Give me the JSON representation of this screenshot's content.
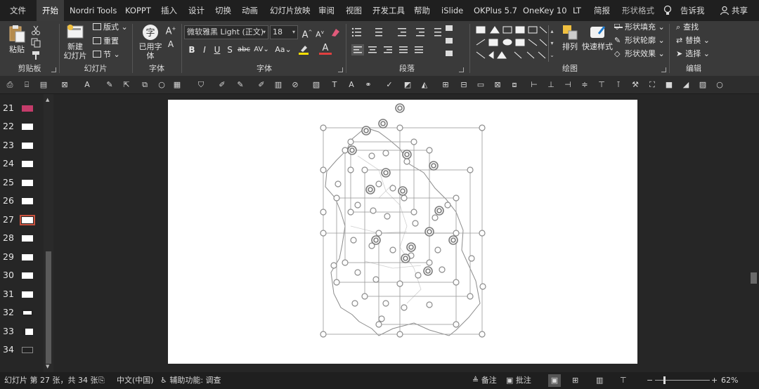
{
  "menu": {
    "tabs": [
      "文件",
      "开始",
      "Nordri Tools",
      "KOPPT",
      "插入",
      "设计",
      "切换",
      "动画",
      "幻灯片放映",
      "审阅",
      "视图",
      "开发工具",
      "帮助",
      "iSlide",
      "OKPlus 5.7",
      "OneKey 10",
      "LT",
      "简报"
    ],
    "context_tab": "形状格式",
    "tell_me": "告诉我",
    "share": "共享"
  },
  "ribbon": {
    "clipboard": {
      "label": "剪贴板",
      "paste": "粘贴"
    },
    "slides": {
      "label": "幻灯片",
      "new_slide_line1": "新建",
      "new_slide_line2": "幻灯片",
      "layout": "版式",
      "reset": "重置",
      "section": "节"
    },
    "font_tools": {
      "label": "字体",
      "btn_line1": "已用字",
      "btn_line2": "体"
    },
    "font": {
      "label": "字体",
      "name": "微软雅黑 Light (正文)",
      "size": "18",
      "bold": "B",
      "italic": "I",
      "underline": "U",
      "shadow": "S",
      "strike": "abc",
      "spacing": "AV",
      "case": "Aa",
      "color": "A"
    },
    "paragraph": {
      "label": "段落"
    },
    "drawing": {
      "label": "绘图",
      "arrange": "排列",
      "quick_styles": "快速样式",
      "fill": "形状填充",
      "outline": "形状轮廓",
      "effects": "形状效果"
    },
    "editing": {
      "label": "编辑",
      "find": "查找",
      "replace": "替换",
      "select": "选择"
    }
  },
  "thumbnails": {
    "numbers": [
      "21",
      "22",
      "23",
      "24",
      "25",
      "26",
      "27",
      "28",
      "29",
      "30",
      "31",
      "32",
      "33",
      "34"
    ],
    "selected": "27"
  },
  "status": {
    "slide_info": "幻灯片 第 27 张，共 34 张",
    "language": "中文(中国)",
    "accessibility": "辅助功能: 调查",
    "notes": "备注",
    "comments": "批注",
    "zoom": "62%"
  },
  "colors": {
    "menubar": "#1f1f1f",
    "ribbon": "#3a3a3a",
    "background": "#262626",
    "selection_accent": "#c8513e",
    "slide": "#ffffff",
    "handle_stroke": "#8c8c8c"
  }
}
